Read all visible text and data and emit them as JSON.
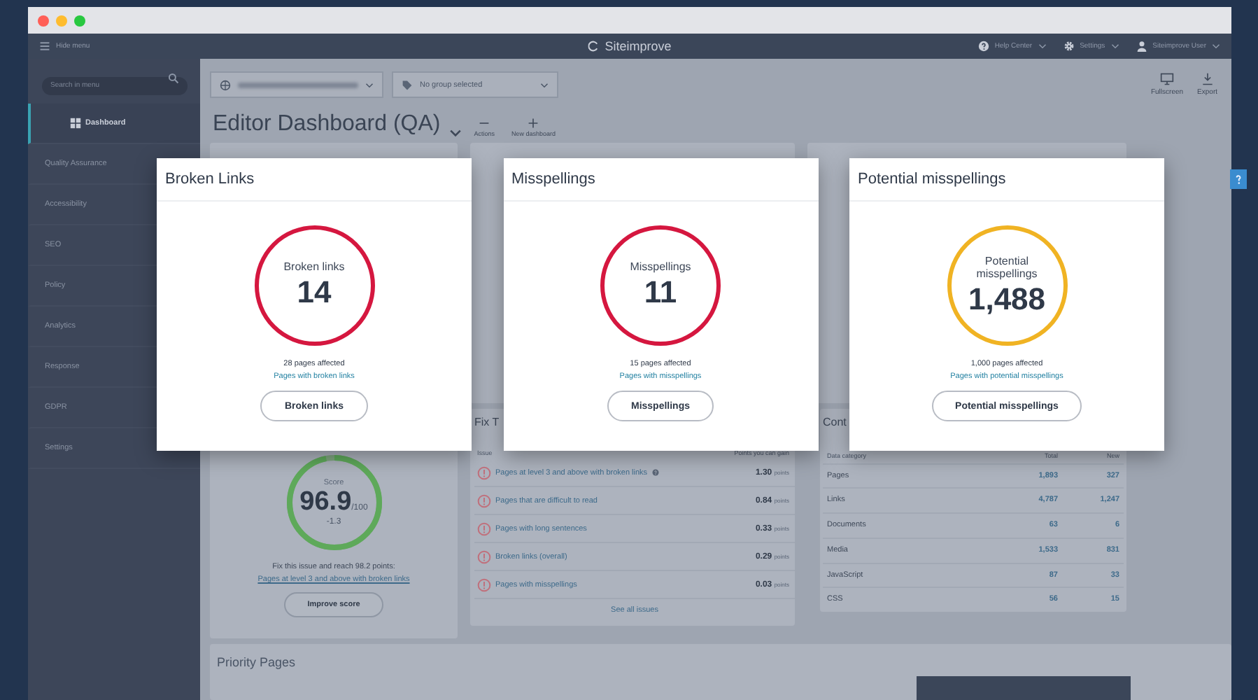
{
  "window": {
    "controls": [
      {
        "color": "#ff5f57"
      },
      {
        "color": "#febc2e"
      },
      {
        "color": "#28c840"
      }
    ]
  },
  "topbar": {
    "menu_toggle": "Hide menu",
    "logo": "Siteimprove",
    "menus": [
      {
        "kind": "help",
        "label": "Help Center"
      },
      {
        "kind": "settings",
        "label": "Settings"
      },
      {
        "kind": "user",
        "label": "Siteimprove User"
      }
    ]
  },
  "sidebar": {
    "search_placeholder": "Search in menu",
    "items": [
      {
        "label": "Dashboard",
        "selected": true
      },
      {
        "label": "Quality Assurance",
        "selected": false
      },
      {
        "label": "Accessibility",
        "selected": false
      },
      {
        "label": "SEO",
        "selected": false
      },
      {
        "label": "Policy",
        "selected": false
      },
      {
        "label": "Analytics",
        "selected": false
      },
      {
        "label": "Response",
        "selected": false
      },
      {
        "label": "GDPR",
        "selected": false
      },
      {
        "label": "Settings",
        "selected": false
      }
    ]
  },
  "toolbar": {
    "group_select": "No group selected",
    "actions": [
      {
        "kind": "fullscreen",
        "label": "Fullscreen"
      },
      {
        "kind": "export",
        "label": "Export"
      }
    ]
  },
  "dashboard": {
    "title": "Editor Dashboard (QA)",
    "actions": [
      {
        "kind": "minus",
        "label": "Actions"
      },
      {
        "kind": "plus",
        "label": "New dashboard"
      }
    ]
  },
  "popups": [
    {
      "title": "Broken Links",
      "circle_label": "Broken links",
      "value": "14",
      "color": "#d5173f",
      "pages_affected": "28 pages affected",
      "link": "Pages with broken links",
      "button": "Broken links"
    },
    {
      "title": "Misspellings",
      "circle_label": "Misspellings",
      "value": "11",
      "color": "#d5173f",
      "pages_affected": "15 pages affected",
      "link": "Pages with misspellings",
      "button": "Misspellings"
    },
    {
      "title": "Potential misspellings",
      "circle_label": "Potential misspellings",
      "value": "1,488",
      "color": "#f0b323",
      "pages_affected": "1,000 pages affected",
      "link": "Pages with potential misspellings",
      "button": "Potential misspellings"
    }
  ],
  "score": {
    "label": "Score",
    "value": "96.9",
    "max": "/100",
    "change": "-1.3",
    "level": 0.969,
    "text": "Fix this issue and reach 98.2 points: ",
    "link": "Pages at level 3 and above with broken links",
    "button": "Improve score"
  },
  "issues": {
    "title": "Fix T",
    "columns": [
      "Issue",
      "Points you can gain"
    ],
    "rows": [
      {
        "label": "Pages at level 3 and above with broken links",
        "points": "1.30",
        "unit": "points",
        "help": true
      },
      {
        "label": "Pages that are difficult to read",
        "points": "0.84",
        "unit": "points",
        "help": false
      },
      {
        "label": "Pages with long sentences",
        "points": "0.33",
        "unit": "points",
        "help": false
      },
      {
        "label": "Broken links (overall)",
        "points": "0.29",
        "unit": "points",
        "help": false
      },
      {
        "label": "Pages with misspellings",
        "points": "0.03",
        "unit": "points",
        "help": false
      }
    ],
    "footer": "See all issues"
  },
  "content": {
    "title": "Cont",
    "columns": [
      "Data category",
      "Total",
      "New"
    ],
    "rows": [
      [
        "Pages",
        "1,893",
        "327"
      ],
      [
        "Links",
        "4,787",
        "1,247"
      ],
      [
        "Documents",
        "63",
        "6"
      ],
      [
        "Media",
        "1,533",
        "831"
      ],
      [
        "JavaScript",
        "87",
        "33"
      ],
      [
        "CSS",
        "56",
        "15"
      ]
    ]
  },
  "priority": {
    "title": "Priority Pages"
  }
}
